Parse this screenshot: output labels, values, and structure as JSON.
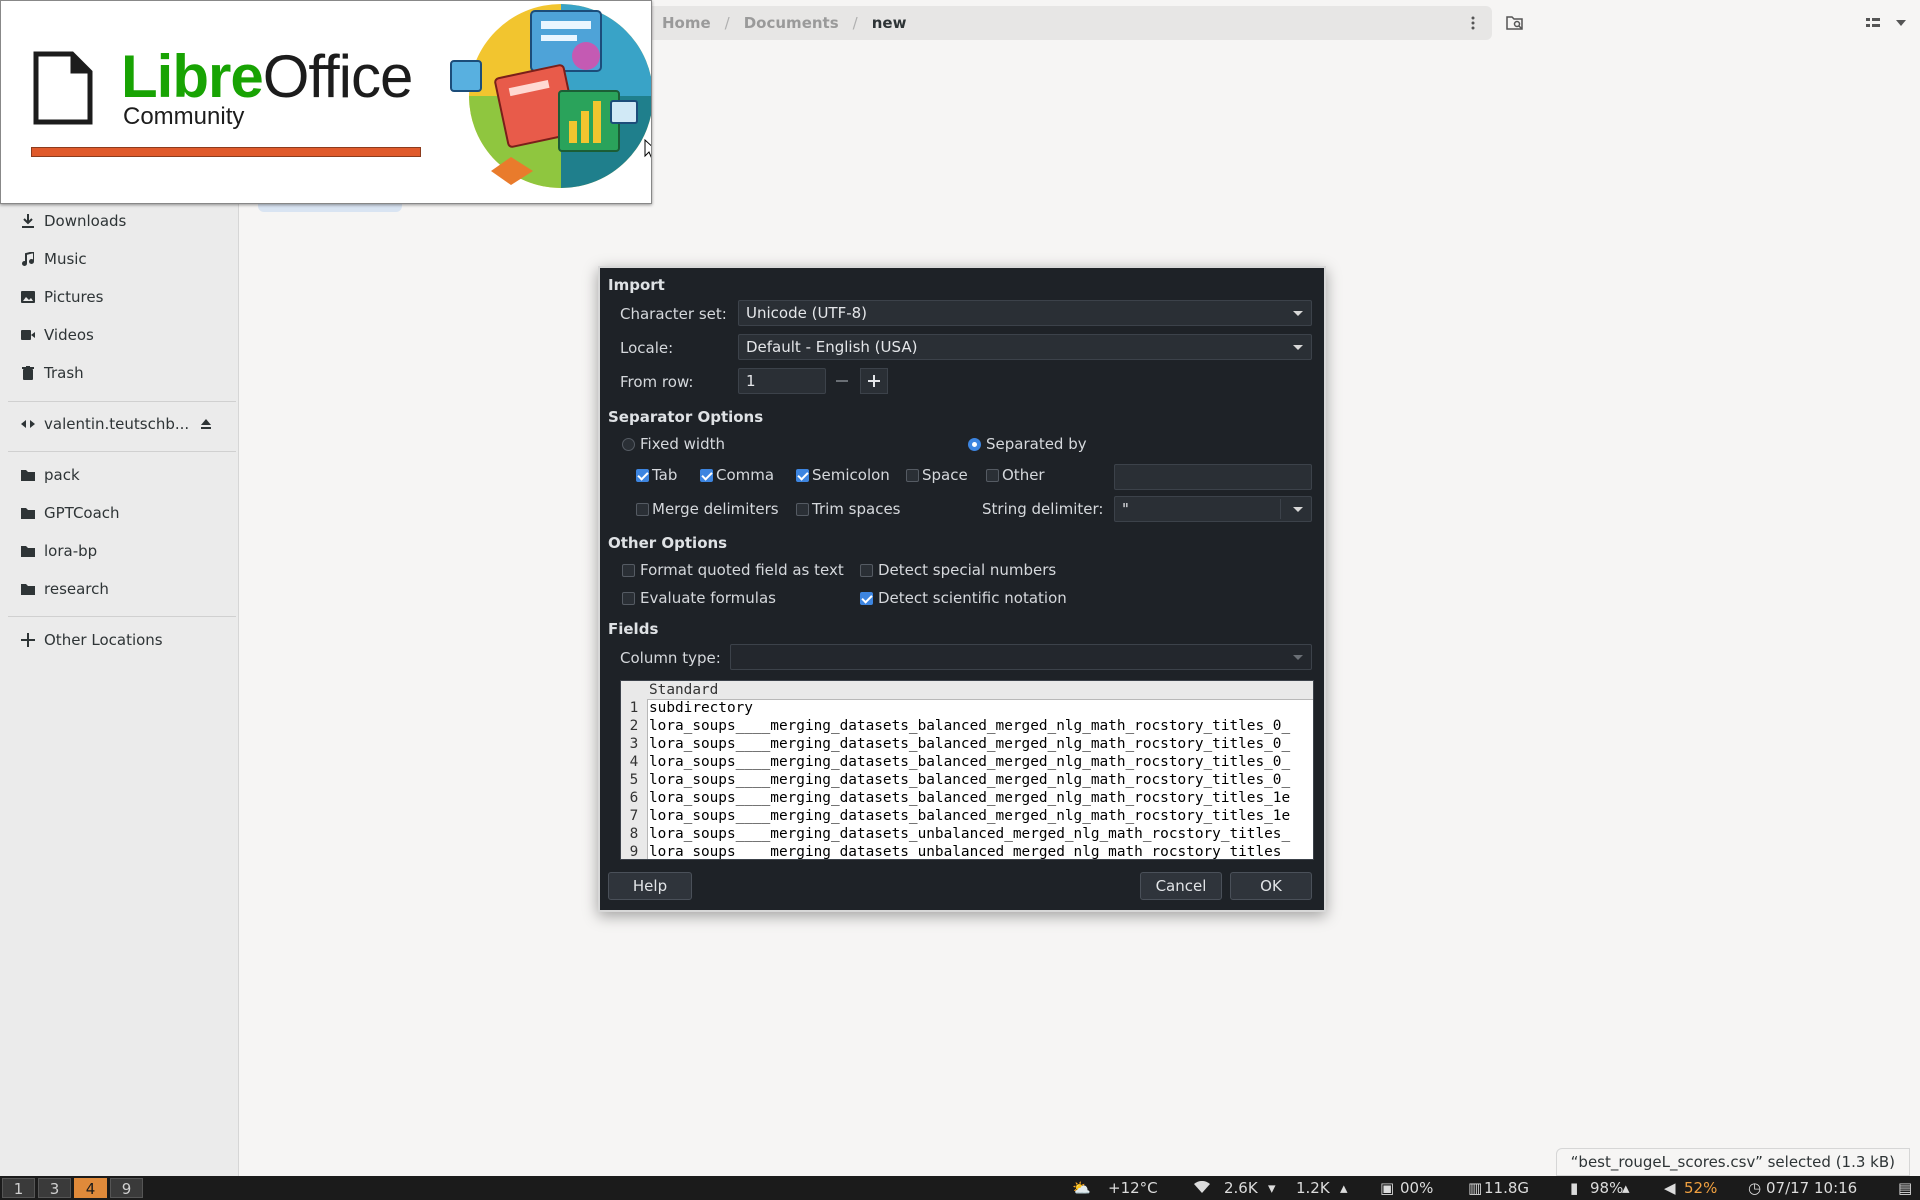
{
  "filemanager": {
    "path": [
      "Home",
      "Documents",
      "new"
    ],
    "sidebar_items": [
      {
        "label": "Downloads",
        "icon": "download-icon"
      },
      {
        "label": "Music",
        "icon": "music-icon"
      },
      {
        "label": "Pictures",
        "icon": "pictures-icon"
      },
      {
        "label": "Videos",
        "icon": "video-icon"
      },
      {
        "label": "Trash",
        "icon": "trash-icon"
      }
    ],
    "network_drive": "valentin.teutschb...",
    "bookmarks": [
      "pack",
      "GPTCoach",
      "lora-bp",
      "research"
    ],
    "other_locations": "Other Locations",
    "status": "“best_rougeL_scores.csv” selected  (1.3 kB)"
  },
  "splash": {
    "brand_libre": "Libre",
    "brand_office": "Office",
    "edition": "Community",
    "progress": 1.0
  },
  "dialog": {
    "import_title": "Import",
    "charset_label": "Character set:",
    "charset_value": "Unicode (UTF-8)",
    "locale_label": "Locale:",
    "locale_value": "Default - English (USA)",
    "from_row_label": "From row:",
    "from_row_value": "1",
    "separator_title": "Separator Options",
    "fixed_width": "Fixed width",
    "separated_by": "Separated by",
    "tab": "Tab",
    "comma": "Comma",
    "semicolon": "Semicolon",
    "space": "Space",
    "other": "Other",
    "merge_delimiters": "Merge delimiters",
    "trim_spaces": "Trim spaces",
    "string_delimiter_label": "String delimiter:",
    "string_delimiter_value": "\"",
    "other_options_title": "Other Options",
    "format_quoted": "Format quoted field as text",
    "detect_special": "Detect special numbers",
    "evaluate_formulas": "Evaluate formulas",
    "detect_scientific": "Detect scientific notation",
    "fields_title": "Fields",
    "column_type_label": "Column type:",
    "column_type_value": "",
    "preview_header": "Standard",
    "preview_rows": [
      {
        "n": "1",
        "text": "subdirectory"
      },
      {
        "n": "2",
        "text": "lora_soups____merging_datasets_balanced_merged_nlg_math_rocstory_titles_0_"
      },
      {
        "n": "3",
        "text": "lora_soups____merging_datasets_balanced_merged_nlg_math_rocstory_titles_0_"
      },
      {
        "n": "4",
        "text": "lora_soups____merging_datasets_balanced_merged_nlg_math_rocstory_titles_0_"
      },
      {
        "n": "5",
        "text": "lora_soups____merging_datasets_balanced_merged_nlg_math_rocstory_titles_0_"
      },
      {
        "n": "6",
        "text": "lora_soups____merging_datasets_balanced_merged_nlg_math_rocstory_titles_1e"
      },
      {
        "n": "7",
        "text": "lora_soups____merging_datasets_balanced_merged_nlg_math_rocstory_titles_1e"
      },
      {
        "n": "8",
        "text": "lora_soups____merging_datasets_unbalanced_merged_nlg_math_rocstory_titles_"
      },
      {
        "n": "9",
        "text": "lora_soups____merging_datasets_unbalanced_merged_nlg_math_rocstory_titles_"
      }
    ],
    "help": "Help",
    "cancel": "Cancel",
    "ok": "OK",
    "checked": {
      "tab": true,
      "comma": true,
      "semicolon": true,
      "space": false,
      "other": false,
      "merge": false,
      "trim": false,
      "format_quoted": false,
      "detect_special": false,
      "evaluate": false,
      "detect_scientific": true
    },
    "separator_mode": "separated_by"
  },
  "taskbar": {
    "workspaces": [
      "1",
      "3",
      "4",
      "9"
    ],
    "active_workspace": "4",
    "weather": "+12°C",
    "net_down": "2.6K",
    "net_up": "1.2K",
    "cpu": "00%",
    "disk": "11.8G",
    "battery": "98%",
    "volume": "52%",
    "datetime": "07/17 10:16"
  }
}
